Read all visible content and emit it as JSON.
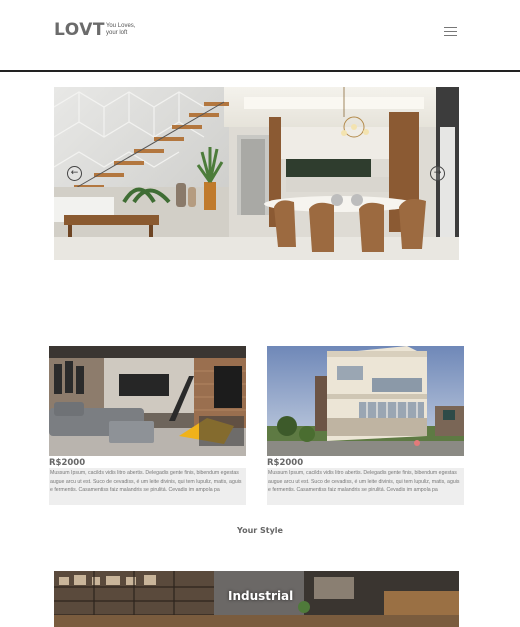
{
  "header": {
    "logo": {
      "word": "LOVT",
      "tagline_line1": "You Loves,",
      "tagline_line2": "your loft"
    },
    "menu_icon": "hamburger-menu-icon"
  },
  "hero": {
    "prev_icon": "arrow-left-icon",
    "next_icon": "arrow-right-icon",
    "prev_glyph": "←",
    "next_glyph": "→"
  },
  "listings": [
    {
      "price": "R$2000",
      "description": "Mussum Ipsum, cacilds vidis litro abertis. Delegadis gente finis, bibendum egestas augue arcu ut est. Suco de cevadiss, é um leite divinis, qui tem lupuliz, matis, aguis e fermentis. Casamentiss faiz malandris se pirulitá. Cevadis im ampola pa"
    },
    {
      "price": "R$2000",
      "description": "Mussum Ipsum, cacilds vidis litro abertis. Delegadis gente finis, bibendum egestas augue arcu ut est. Suco de cevadiss, é um leite divinis, qui tem lupuliz, matis, aguis e fermentis. Casamentiss faiz malandris se pirulitá. Cevadis im ampola pa"
    }
  ],
  "styles": {
    "title": "Your Style",
    "banner_label": "Industrial"
  },
  "colors": {
    "text": "#555555",
    "divider": "#222222",
    "card_desc_bg": "#eeeeee"
  }
}
